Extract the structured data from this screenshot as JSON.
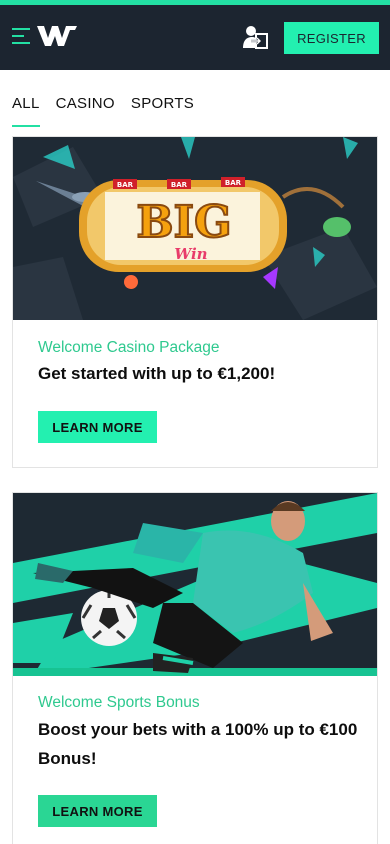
{
  "header": {
    "register_label": "REGISTER",
    "accent": "#23f0b0",
    "background": "#1c2530",
    "icons": [
      "menu-icon",
      "brand-logo",
      "login-icon"
    ]
  },
  "tabs": [
    {
      "label": "ALL",
      "active": true
    },
    {
      "label": "CASINO",
      "active": false
    },
    {
      "label": "SPORTS",
      "active": false
    }
  ],
  "promotions": [
    {
      "banner": "big-win-slot-banner",
      "subtitle": "Welcome Casino Package",
      "headline": "Get started with up to €1,200!",
      "button_label": "LEARN MORE",
      "banner_text": [
        "BAR",
        "BAR",
        "BAR",
        "BIG",
        "Win"
      ]
    },
    {
      "banner": "soccer-player-banner",
      "subtitle": "Welcome Sports Bonus",
      "headline": "Boost your bets with a 100% up to €100 Bonus!",
      "button_label": "LEARN MORE"
    }
  ]
}
